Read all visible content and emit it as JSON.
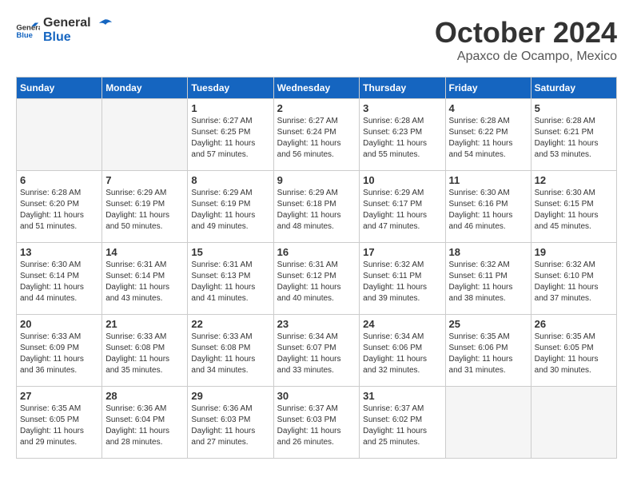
{
  "logo": {
    "general": "General",
    "blue": "Blue"
  },
  "title": "October 2024",
  "location": "Apaxco de Ocampo, Mexico",
  "weekdays": [
    "Sunday",
    "Monday",
    "Tuesday",
    "Wednesday",
    "Thursday",
    "Friday",
    "Saturday"
  ],
  "weeks": [
    [
      {
        "day": "",
        "sunrise": "",
        "sunset": "",
        "daylight": ""
      },
      {
        "day": "",
        "sunrise": "",
        "sunset": "",
        "daylight": ""
      },
      {
        "day": "1",
        "sunrise": "Sunrise: 6:27 AM",
        "sunset": "Sunset: 6:25 PM",
        "daylight": "Daylight: 11 hours and 57 minutes."
      },
      {
        "day": "2",
        "sunrise": "Sunrise: 6:27 AM",
        "sunset": "Sunset: 6:24 PM",
        "daylight": "Daylight: 11 hours and 56 minutes."
      },
      {
        "day": "3",
        "sunrise": "Sunrise: 6:28 AM",
        "sunset": "Sunset: 6:23 PM",
        "daylight": "Daylight: 11 hours and 55 minutes."
      },
      {
        "day": "4",
        "sunrise": "Sunrise: 6:28 AM",
        "sunset": "Sunset: 6:22 PM",
        "daylight": "Daylight: 11 hours and 54 minutes."
      },
      {
        "day": "5",
        "sunrise": "Sunrise: 6:28 AM",
        "sunset": "Sunset: 6:21 PM",
        "daylight": "Daylight: 11 hours and 53 minutes."
      }
    ],
    [
      {
        "day": "6",
        "sunrise": "Sunrise: 6:28 AM",
        "sunset": "Sunset: 6:20 PM",
        "daylight": "Daylight: 11 hours and 51 minutes."
      },
      {
        "day": "7",
        "sunrise": "Sunrise: 6:29 AM",
        "sunset": "Sunset: 6:19 PM",
        "daylight": "Daylight: 11 hours and 50 minutes."
      },
      {
        "day": "8",
        "sunrise": "Sunrise: 6:29 AM",
        "sunset": "Sunset: 6:19 PM",
        "daylight": "Daylight: 11 hours and 49 minutes."
      },
      {
        "day": "9",
        "sunrise": "Sunrise: 6:29 AM",
        "sunset": "Sunset: 6:18 PM",
        "daylight": "Daylight: 11 hours and 48 minutes."
      },
      {
        "day": "10",
        "sunrise": "Sunrise: 6:29 AM",
        "sunset": "Sunset: 6:17 PM",
        "daylight": "Daylight: 11 hours and 47 minutes."
      },
      {
        "day": "11",
        "sunrise": "Sunrise: 6:30 AM",
        "sunset": "Sunset: 6:16 PM",
        "daylight": "Daylight: 11 hours and 46 minutes."
      },
      {
        "day": "12",
        "sunrise": "Sunrise: 6:30 AM",
        "sunset": "Sunset: 6:15 PM",
        "daylight": "Daylight: 11 hours and 45 minutes."
      }
    ],
    [
      {
        "day": "13",
        "sunrise": "Sunrise: 6:30 AM",
        "sunset": "Sunset: 6:14 PM",
        "daylight": "Daylight: 11 hours and 44 minutes."
      },
      {
        "day": "14",
        "sunrise": "Sunrise: 6:31 AM",
        "sunset": "Sunset: 6:14 PM",
        "daylight": "Daylight: 11 hours and 43 minutes."
      },
      {
        "day": "15",
        "sunrise": "Sunrise: 6:31 AM",
        "sunset": "Sunset: 6:13 PM",
        "daylight": "Daylight: 11 hours and 41 minutes."
      },
      {
        "day": "16",
        "sunrise": "Sunrise: 6:31 AM",
        "sunset": "Sunset: 6:12 PM",
        "daylight": "Daylight: 11 hours and 40 minutes."
      },
      {
        "day": "17",
        "sunrise": "Sunrise: 6:32 AM",
        "sunset": "Sunset: 6:11 PM",
        "daylight": "Daylight: 11 hours and 39 minutes."
      },
      {
        "day": "18",
        "sunrise": "Sunrise: 6:32 AM",
        "sunset": "Sunset: 6:11 PM",
        "daylight": "Daylight: 11 hours and 38 minutes."
      },
      {
        "day": "19",
        "sunrise": "Sunrise: 6:32 AM",
        "sunset": "Sunset: 6:10 PM",
        "daylight": "Daylight: 11 hours and 37 minutes."
      }
    ],
    [
      {
        "day": "20",
        "sunrise": "Sunrise: 6:33 AM",
        "sunset": "Sunset: 6:09 PM",
        "daylight": "Daylight: 11 hours and 36 minutes."
      },
      {
        "day": "21",
        "sunrise": "Sunrise: 6:33 AM",
        "sunset": "Sunset: 6:08 PM",
        "daylight": "Daylight: 11 hours and 35 minutes."
      },
      {
        "day": "22",
        "sunrise": "Sunrise: 6:33 AM",
        "sunset": "Sunset: 6:08 PM",
        "daylight": "Daylight: 11 hours and 34 minutes."
      },
      {
        "day": "23",
        "sunrise": "Sunrise: 6:34 AM",
        "sunset": "Sunset: 6:07 PM",
        "daylight": "Daylight: 11 hours and 33 minutes."
      },
      {
        "day": "24",
        "sunrise": "Sunrise: 6:34 AM",
        "sunset": "Sunset: 6:06 PM",
        "daylight": "Daylight: 11 hours and 32 minutes."
      },
      {
        "day": "25",
        "sunrise": "Sunrise: 6:35 AM",
        "sunset": "Sunset: 6:06 PM",
        "daylight": "Daylight: 11 hours and 31 minutes."
      },
      {
        "day": "26",
        "sunrise": "Sunrise: 6:35 AM",
        "sunset": "Sunset: 6:05 PM",
        "daylight": "Daylight: 11 hours and 30 minutes."
      }
    ],
    [
      {
        "day": "27",
        "sunrise": "Sunrise: 6:35 AM",
        "sunset": "Sunset: 6:05 PM",
        "daylight": "Daylight: 11 hours and 29 minutes."
      },
      {
        "day": "28",
        "sunrise": "Sunrise: 6:36 AM",
        "sunset": "Sunset: 6:04 PM",
        "daylight": "Daylight: 11 hours and 28 minutes."
      },
      {
        "day": "29",
        "sunrise": "Sunrise: 6:36 AM",
        "sunset": "Sunset: 6:03 PM",
        "daylight": "Daylight: 11 hours and 27 minutes."
      },
      {
        "day": "30",
        "sunrise": "Sunrise: 6:37 AM",
        "sunset": "Sunset: 6:03 PM",
        "daylight": "Daylight: 11 hours and 26 minutes."
      },
      {
        "day": "31",
        "sunrise": "Sunrise: 6:37 AM",
        "sunset": "Sunset: 6:02 PM",
        "daylight": "Daylight: 11 hours and 25 minutes."
      },
      {
        "day": "",
        "sunrise": "",
        "sunset": "",
        "daylight": ""
      },
      {
        "day": "",
        "sunrise": "",
        "sunset": "",
        "daylight": ""
      }
    ]
  ]
}
